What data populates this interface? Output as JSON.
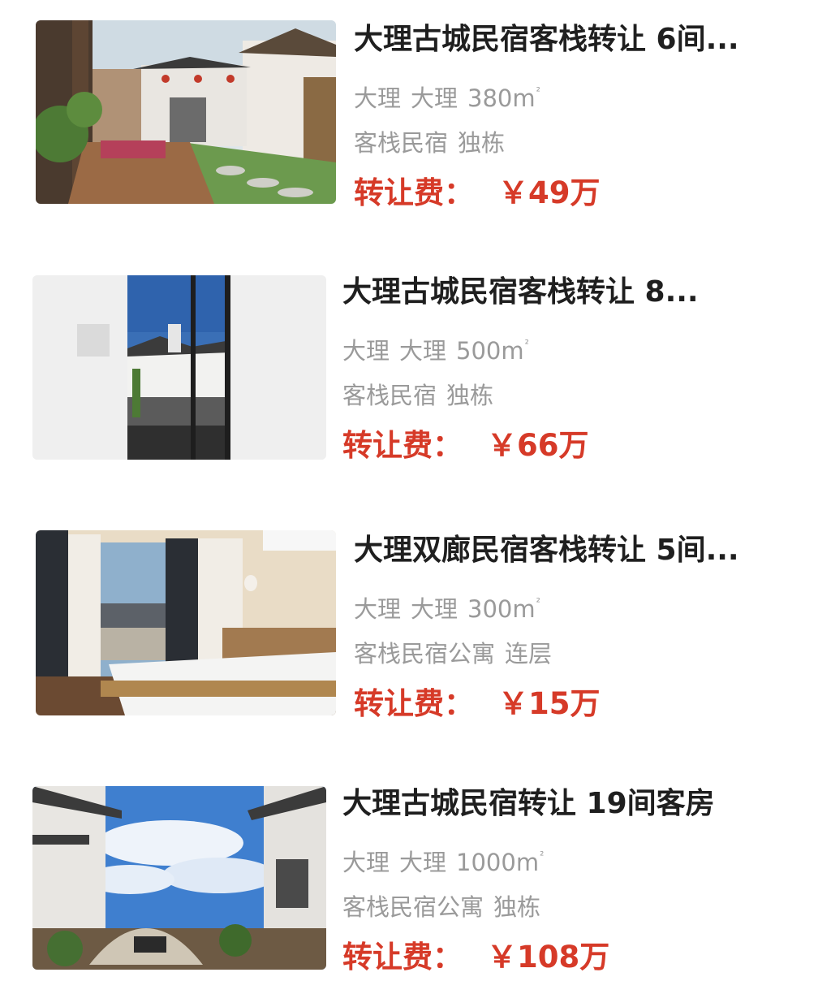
{
  "listings": [
    {
      "title": "大理古城民宿客栈转让 6间...",
      "city": "大理",
      "district": "大理",
      "area": "380m",
      "area_sup": "²",
      "type": "客栈民宿",
      "building": "独栋",
      "fee_label": "转让费：",
      "fee_value": "￥49万",
      "image_icon": "courtyard-photo"
    },
    {
      "title": "大理古城民宿客栈转让 8...",
      "city": "大理",
      "district": "大理",
      "area": "500m",
      "area_sup": "²",
      "type": "客栈民宿",
      "building": "独栋",
      "fee_label": "转让费：",
      "fee_value": "￥66万",
      "image_icon": "glass-door-photo"
    },
    {
      "title": "大理双廊民宿客栈转让 5间...",
      "city": "大理",
      "district": "大理",
      "area": "300m",
      "area_sup": "²",
      "type": "客栈民宿公寓",
      "building": "连层",
      "fee_label": "转让费：",
      "fee_value": "￥15万",
      "image_icon": "bedroom-photo"
    },
    {
      "title": "大理古城民宿转让 19间客房",
      "city": "大理",
      "district": "大理",
      "area": "1000m",
      "area_sup": "²",
      "type": "客栈民宿公寓",
      "building": "独栋",
      "fee_label": "转让费：",
      "fee_value": "￥108万",
      "image_icon": "sky-courtyard-photo"
    }
  ],
  "colors": {
    "title": "#1f1f1f",
    "meta": "#9a9a9a",
    "fee": "#d63a28"
  }
}
